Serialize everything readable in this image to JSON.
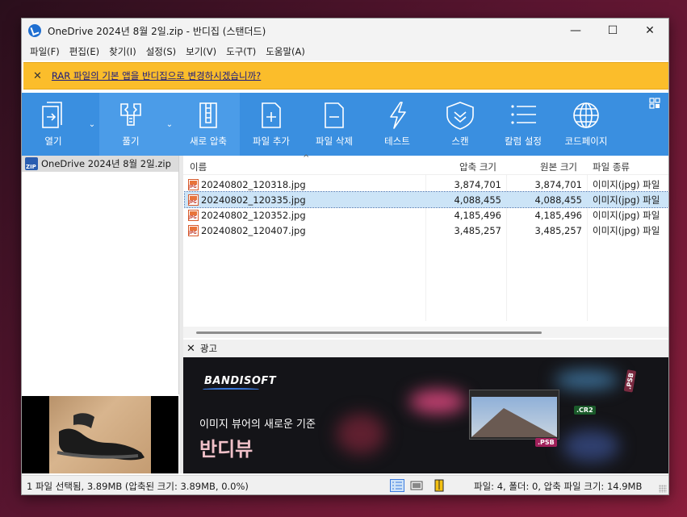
{
  "window": {
    "title": "OneDrive 2024년 8월 2일.zip - 반디집 (스탠더드)"
  },
  "window_buttons": {
    "minimize": "—",
    "maximize": "☐",
    "close": "✕"
  },
  "menu": [
    "파일(F)",
    "편집(E)",
    "찾기(I)",
    "설정(S)",
    "보기(V)",
    "도구(T)",
    "도움말(A)"
  ],
  "notice": {
    "close": "✕",
    "text": "RAR 파일의 기본 앱을 반디집으로 변경하시겠습니까?"
  },
  "toolbar": {
    "open": "열기",
    "extract": "풀기",
    "new": "새로 압축",
    "add": "파일 추가",
    "delete": "파일 삭제",
    "test": "테스트",
    "scan": "스캔",
    "columns": "칼럼 설정",
    "codepage": "코드페이지"
  },
  "tree": {
    "root": "OneDrive 2024년 8월 2일.zip",
    "zip_badge": "ZIP"
  },
  "list": {
    "sort_indicator": "^",
    "headers": {
      "name": "이름",
      "packed": "압축 크기",
      "original": "원본 크기",
      "type": "파일 종류"
    },
    "rows": [
      {
        "name": "20240802_120318.jpg",
        "packed": "3,874,701",
        "original": "3,874,701",
        "type": "이미지(jpg) 파일",
        "selected": false
      },
      {
        "name": "20240802_120335.jpg",
        "packed": "4,088,455",
        "original": "4,088,455",
        "type": "이미지(jpg) 파일",
        "selected": true
      },
      {
        "name": "20240802_120352.jpg",
        "packed": "4,185,496",
        "original": "4,185,496",
        "type": "이미지(jpg) 파일",
        "selected": false
      },
      {
        "name": "20240802_120407.jpg",
        "packed": "3,485,257",
        "original": "3,485,257",
        "type": "이미지(jpg) 파일",
        "selected": false
      }
    ],
    "jpg_badge": "JPG"
  },
  "ad": {
    "close": "✕",
    "label": "광고",
    "brand": "BANDISOFT",
    "tagline": "이미지 뷰어의 새로운 기준",
    "product": "반디뷰",
    "chips": {
      "psb_top": ".PSB",
      "cr2": ".CR2",
      "psb_bottom": ".PSB"
    }
  },
  "status": {
    "left": "1 파일 선택됨, 3.89MB (압축된 크기: 3.89MB, 0.0%)",
    "right": "파일: 4, 폴더: 0, 압축 파일 크기: 14.9MB"
  },
  "colors": {
    "toolbar": "#3a8fe0",
    "notice": "#fbbd2b",
    "selection": "#cce4f7"
  }
}
